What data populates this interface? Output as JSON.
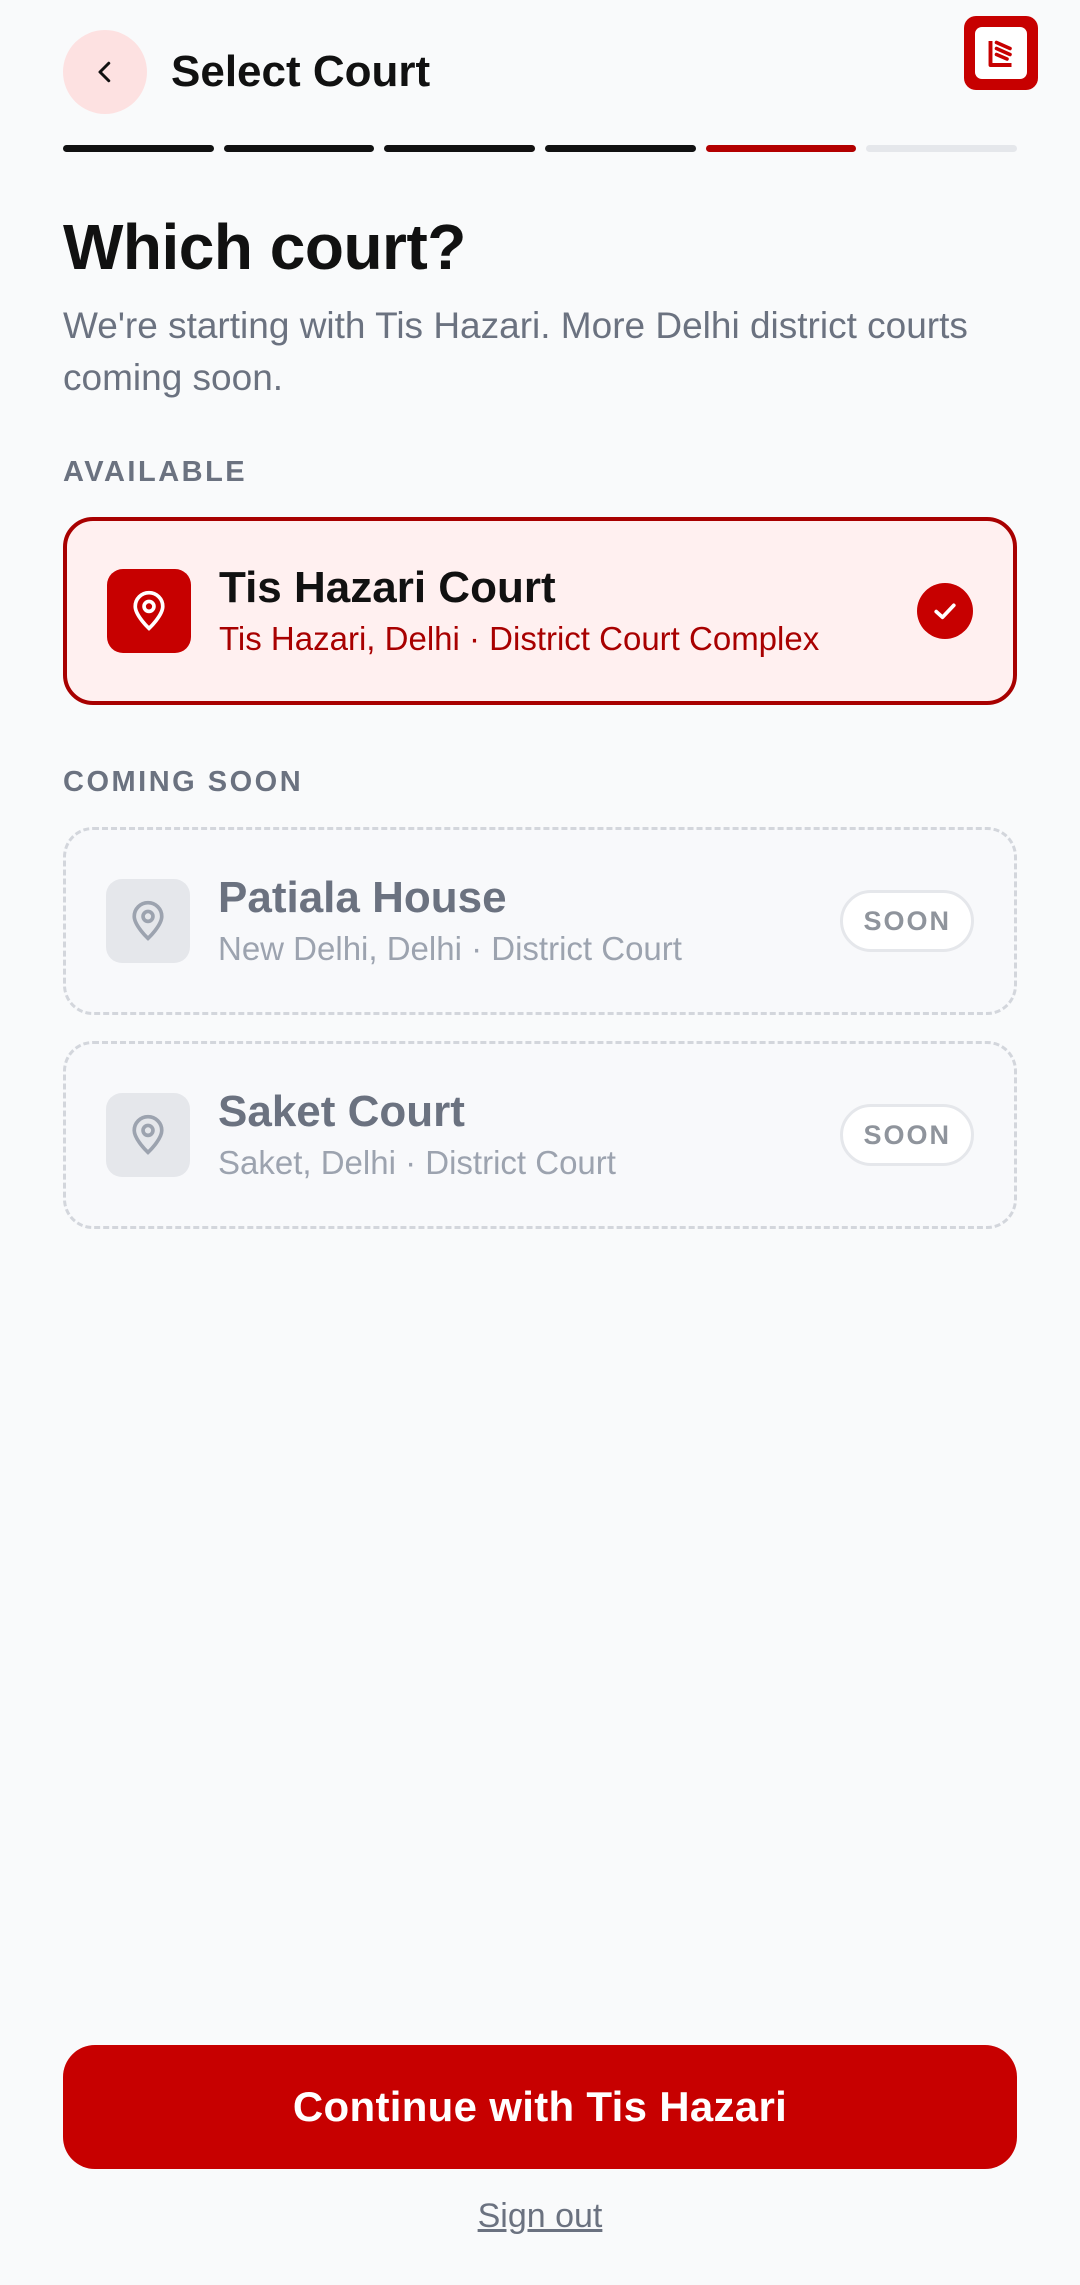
{
  "header": {
    "title": "Select Court",
    "back_icon": "chevron-left-icon",
    "logo_icon": "app-logo-icon"
  },
  "progress": {
    "total_steps": 6,
    "current_step": 5
  },
  "content": {
    "headline": "Which court?",
    "subtitle": "We're starting with Tis Hazari. More Delhi district courts coming soon."
  },
  "available": {
    "label": "AVAILABLE",
    "courts": [
      {
        "name": "Tis Hazari Court",
        "location": "Tis Hazari, Delhi · District Court Complex",
        "selected": true
      }
    ]
  },
  "coming_soon": {
    "label": "COMING SOON",
    "courts": [
      {
        "name": "Patiala House",
        "location": "New Delhi, Delhi · District Court",
        "badge": "SOON"
      },
      {
        "name": "Saket Court",
        "location": "Saket, Delhi · District Court",
        "badge": "SOON"
      }
    ]
  },
  "footer": {
    "continue_label": "Continue with Tis Hazari",
    "signout_label": "Sign out"
  },
  "colors": {
    "accent": "#c70000",
    "accent_dark": "#a80000",
    "accent_soft": "#fff0f0",
    "text_muted": "#6b7280"
  }
}
